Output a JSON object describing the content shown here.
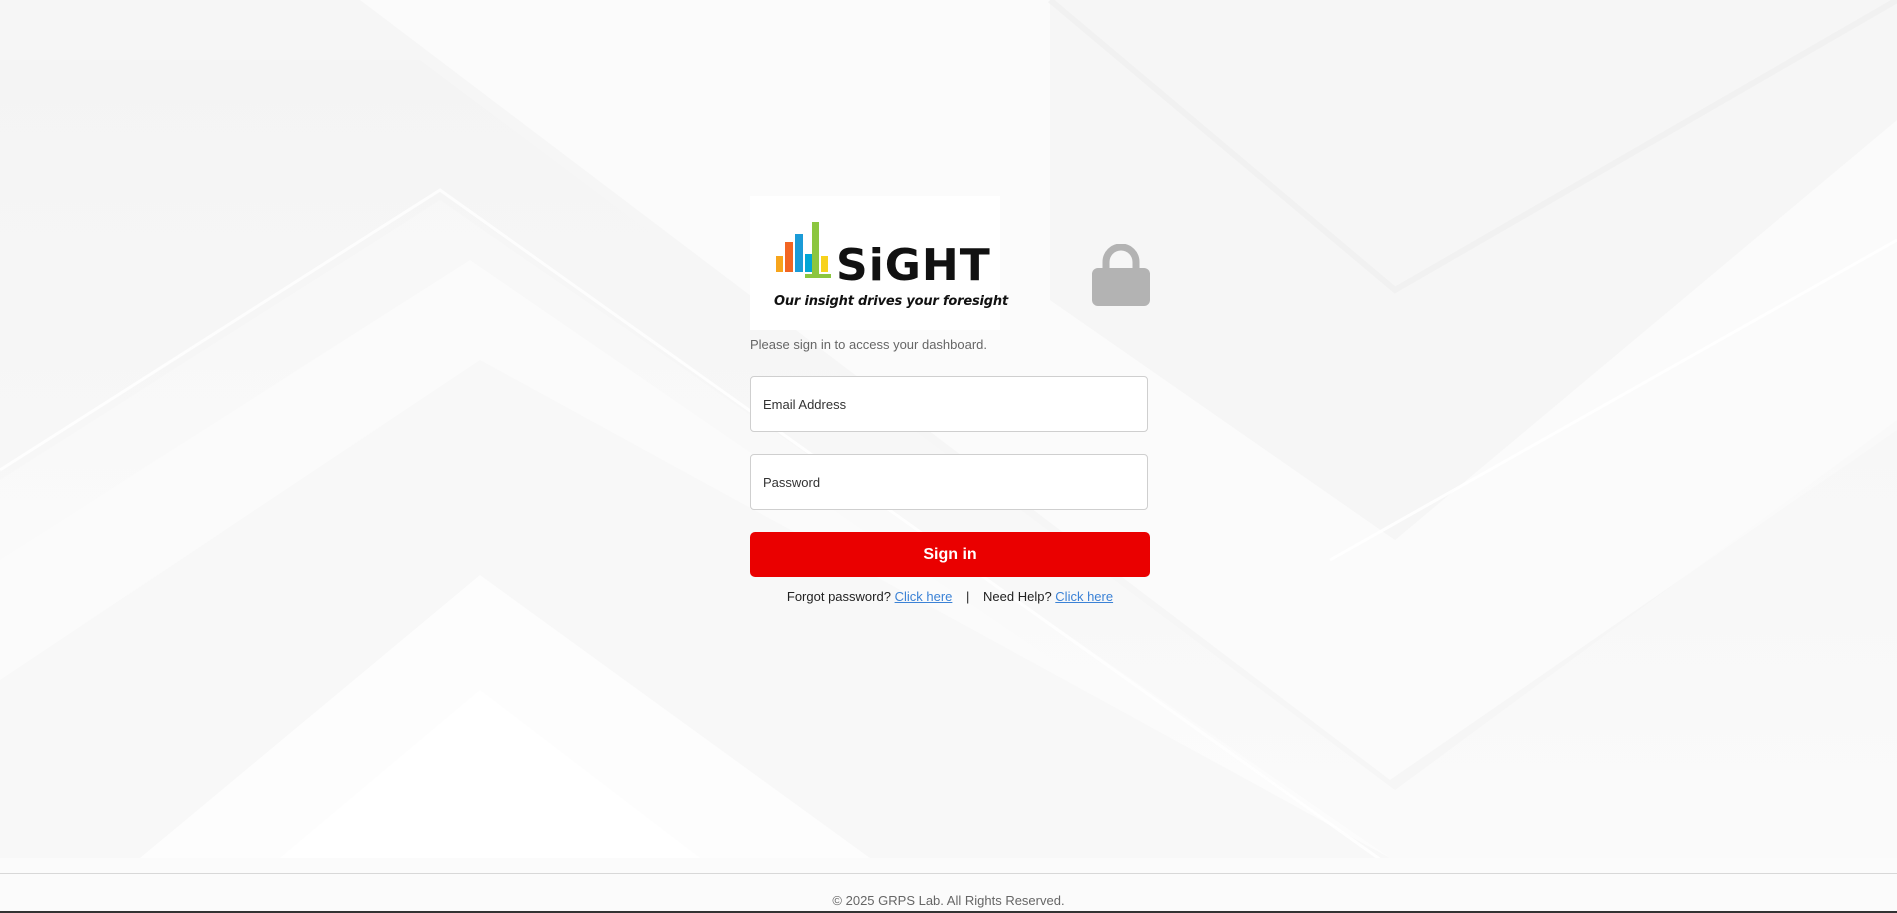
{
  "logo": {
    "wordmark": "SiGHT",
    "tagline": "Our insight drives your foresight",
    "bar_colors": [
      "#f7a51c",
      "#f26522",
      "#1b9bd7",
      "#00a6d6",
      "#8cc63f"
    ]
  },
  "login": {
    "subtitle": "Please sign in to access your dashboard.",
    "email_placeholder": "Email Address",
    "password_placeholder": "Password",
    "signin_label": "Sign in",
    "forgot_text": "Forgot password?",
    "forgot_link": "Click here",
    "separator": "|",
    "help_text": "Need Help?",
    "help_link": "Click here",
    "accent_color": "#ea0000",
    "link_color": "#3b82d6"
  },
  "icons": {
    "lock": "lock-icon"
  },
  "footer": {
    "copyright": "© 2025 GRPS Lab. All Rights Reserved."
  }
}
